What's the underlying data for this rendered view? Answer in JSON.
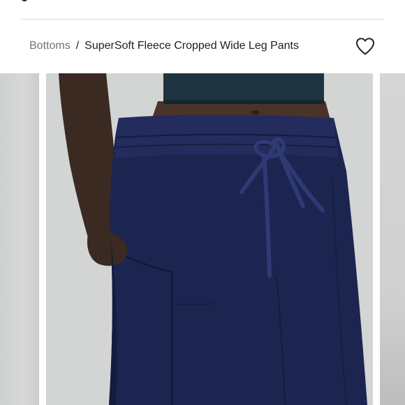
{
  "breadcrumb": {
    "parent_label": "Bottoms",
    "separator": "/",
    "current_label": "SuperSoft Fleece Cropped Wide Leg Pants"
  },
  "wishlist": {
    "icon": "heart-outline-icon"
  },
  "gallery": {
    "main_image": "navy-wide-leg-pants-model-photo",
    "colors": {
      "pants": "#1c2550",
      "top": "#1f3440",
      "background": "#d3d4d4",
      "skin": "#3a2a22"
    }
  }
}
